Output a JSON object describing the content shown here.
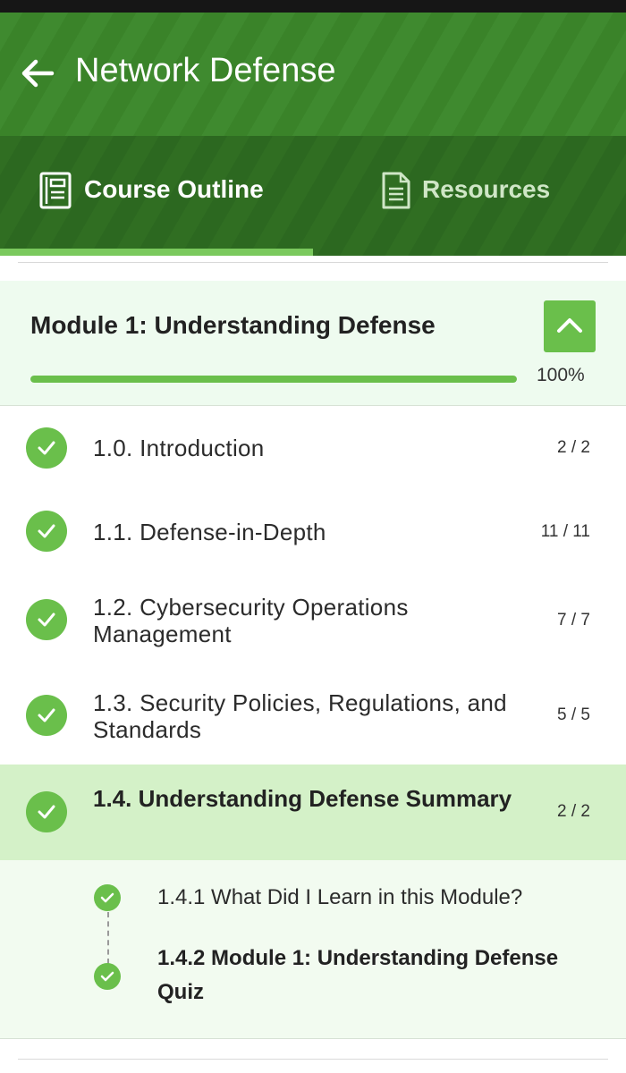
{
  "header": {
    "title": "Network Defense",
    "back_icon": "arrow-left-icon"
  },
  "tabs": [
    {
      "label": "Course Outline",
      "icon": "document-list-icon",
      "active": true
    },
    {
      "label": "Resources",
      "icon": "document-icon",
      "active": false
    }
  ],
  "module": {
    "title": "Module 1: Understanding Defense",
    "progress_text": "100%",
    "progress_fraction": 1.0,
    "collapse_icon": "chevron-up-icon"
  },
  "lessons": [
    {
      "label": "1.0. Introduction",
      "count": "2 / 2",
      "complete": true
    },
    {
      "label": "1.1. Defense-in-Depth",
      "count": "11 / 11",
      "complete": true
    },
    {
      "label": "1.2. Cybersecurity Operations Management",
      "count": "7 / 7",
      "complete": true
    },
    {
      "label": "1.3. Security Policies, Regulations, and Standards",
      "count": "5 / 5",
      "complete": true
    },
    {
      "label": "1.4. Understanding Defense Summary",
      "count": "2 / 2",
      "complete": true,
      "active": true
    }
  ],
  "sub_items": [
    {
      "label": "1.4.1 What Did I Learn in this Module?",
      "complete": true
    },
    {
      "label": "1.4.2 Module 1: Understanding Defense Quiz",
      "complete": true
    }
  ],
  "colors": {
    "brand_green": "#3f8a2f",
    "accent_green": "#6abf4b",
    "active_row": "#d4f1c8"
  }
}
